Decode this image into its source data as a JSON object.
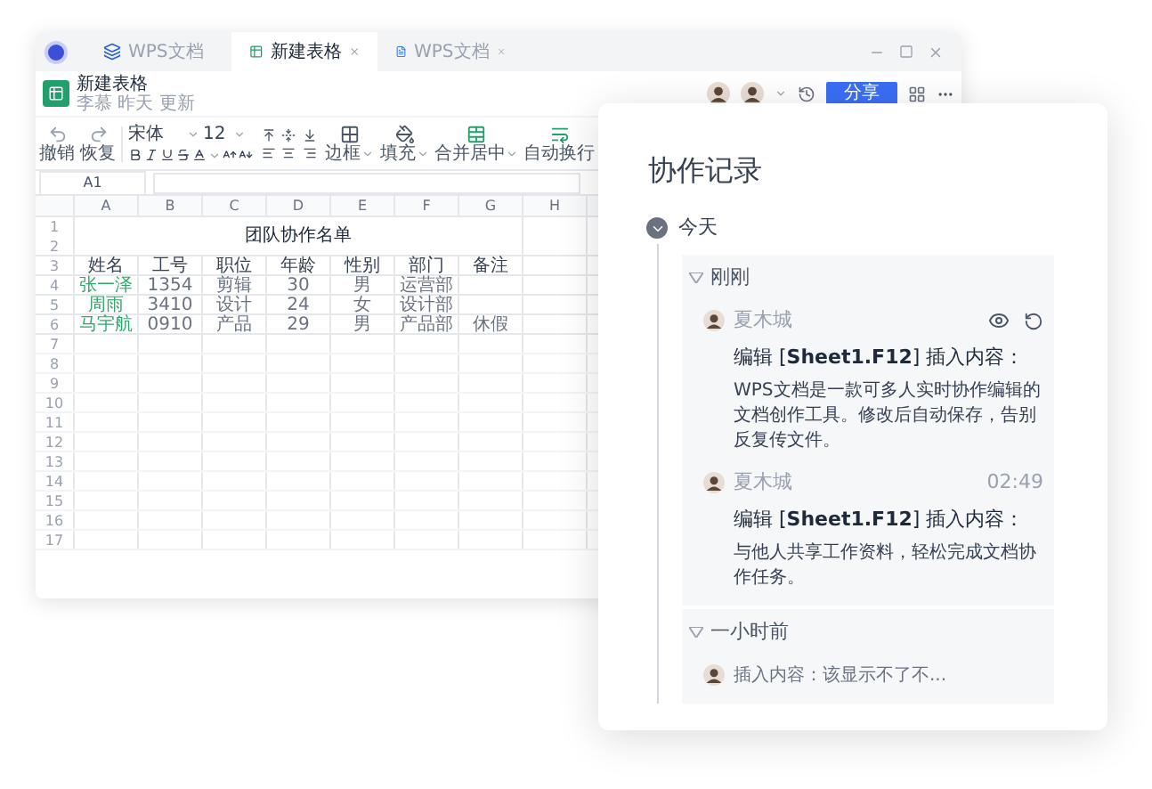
{
  "window": {
    "tabs": [
      {
        "kind": "docs",
        "label": "WPS文档",
        "selected": false
      },
      {
        "kind": "sheet",
        "label": "新建表格",
        "selected": true
      },
      {
        "kind": "doc",
        "label": "WPS文档",
        "selected": false
      }
    ]
  },
  "document": {
    "title": "新建表格",
    "subtitle": "李慕 昨天 更新",
    "share": "分享"
  },
  "toolbar": {
    "undo": "撤销",
    "redo": "恢复",
    "font": "宋体",
    "size": "12",
    "border": "边框",
    "fill": "填充",
    "merge": "合并居中",
    "wrap": "自动换行"
  },
  "name_box": "A1",
  "sheet": {
    "columns": [
      "A",
      "B",
      "C",
      "D",
      "E",
      "F",
      "G",
      "H"
    ],
    "title": {
      "row": "1",
      "text": "团队协作名单"
    },
    "row_2": "2",
    "rows": [
      {
        "number": "3",
        "kind": "header",
        "cells": [
          "姓名",
          "工号",
          "职位",
          "年龄",
          "性别",
          "部门",
          "备注"
        ]
      },
      {
        "number": "4",
        "kind": "data",
        "cells": [
          "张一泽",
          "1354",
          "剪辑",
          "30",
          "男",
          "运营部",
          ""
        ]
      },
      {
        "number": "5",
        "kind": "data",
        "cells": [
          "周雨",
          "3410",
          "设计",
          "24",
          "女",
          "设计部",
          ""
        ]
      },
      {
        "number": "6",
        "kind": "data",
        "cells": [
          "马宇航",
          "0910",
          "产品",
          "29",
          "男",
          "产品部",
          "休假"
        ]
      }
    ],
    "empty_rows": [
      "7",
      "8",
      "9",
      "10",
      "11",
      "12",
      "13",
      "14",
      "15",
      "16",
      "17"
    ]
  },
  "panel": {
    "title": "协作记录",
    "sections": [
      {
        "label": "今天",
        "expanded": true,
        "groups": [
          {
            "label": "刚刚",
            "expanded": true,
            "entries": [
              {
                "kind": "actions",
                "user": "夏木城",
                "action": "编辑 [**Sheet1.F12**] 插入内容：",
                "content": "WPS文档是一款可多人实时协作编辑的文档创作工具。修改后自动保存，告别反复传文件。"
              },
              {
                "kind": "timed",
                "user": "夏木城",
                "time": "02:49",
                "action": "编辑 [**Sheet1.F12**] 插入内容：",
                "content": "与他人共享工作资料，轻松完成文档协作任务。"
              }
            ]
          },
          {
            "label": "一小时前",
            "expanded": true,
            "entries": [
              {
                "kind": "brief",
                "action": "插入内容：该显示不了不..."
              }
            ]
          }
        ]
      }
    ]
  }
}
